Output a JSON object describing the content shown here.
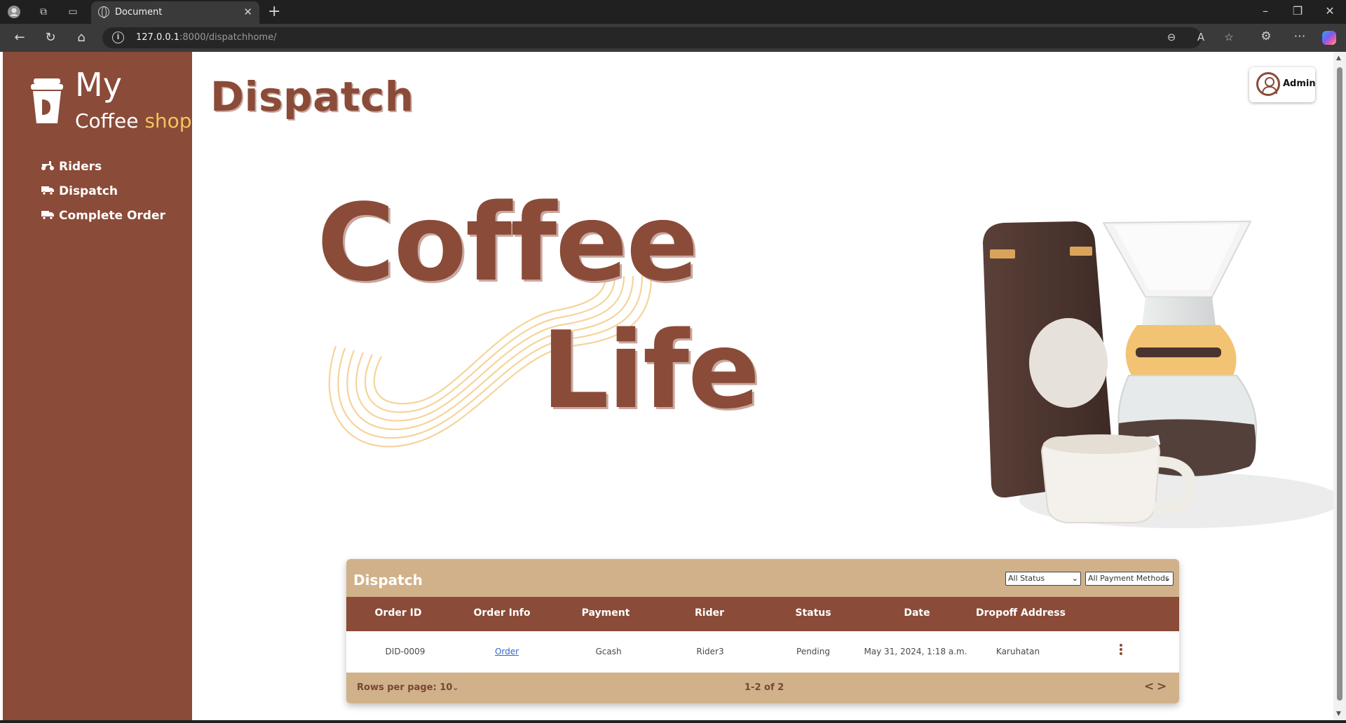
{
  "browser": {
    "tab_title": "Document",
    "url_host": "127.0.0.1",
    "url_path": ":8000/dispatchhome/"
  },
  "sidebar": {
    "logo": {
      "line1": "My",
      "line2_main": "Coffee",
      "line2_accent": "shop"
    },
    "items": [
      {
        "label": "Riders",
        "icon": "scooter-icon"
      },
      {
        "label": "Dispatch",
        "icon": "delivery-truck-icon"
      },
      {
        "label": "Complete Order",
        "icon": "delivery-truck-icon"
      }
    ]
  },
  "header": {
    "title": "Dispatch",
    "user_label": "Admin"
  },
  "hero": {
    "word1": "Coffee",
    "word2": "Life"
  },
  "table": {
    "title": "Dispatch",
    "filters": {
      "status": "All Status",
      "payment": "All Payment Methods"
    },
    "columns": [
      "Order ID",
      "Order Info",
      "Payment",
      "Rider",
      "Status",
      "Date",
      "Dropoff Address"
    ],
    "rows": [
      {
        "order_id": "DID-0009",
        "order_info": "Order",
        "payment": "Gcash",
        "rider": "Rider3",
        "status": "Pending",
        "date": "May 31, 2024, 1:18 a.m.",
        "dropoff": "Karuhatan"
      }
    ],
    "footer": {
      "rows_per_page": "Rows per page: 10",
      "page_info": "1-2 of 2",
      "prev": "<",
      "next": ">"
    }
  },
  "colors": {
    "brand_brown": "#8a4b38",
    "tan": "#d0b18a",
    "accent_yellow": "#f3c45f",
    "link_blue": "#3366cc"
  }
}
